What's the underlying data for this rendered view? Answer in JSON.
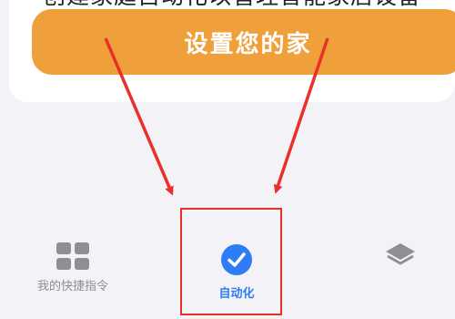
{
  "card": {
    "description": "创建家庭自动化以管理智能家居设备",
    "setup_button_label": "设置您的家"
  },
  "tabbar": {
    "items": [
      {
        "label": "我的快捷指令",
        "icon": "grid-icon",
        "active": false
      },
      {
        "label": "自动化",
        "icon": "checkmark-circle-icon",
        "active": true
      },
      {
        "label": "",
        "icon": "layers-icon",
        "active": false
      }
    ]
  },
  "colors": {
    "button_orange": "#f0a03a",
    "active_blue": "#2e7cf6",
    "inactive_gray": "#8e8e93",
    "annotation_red": "#e8312a",
    "background": "#f2f2f7"
  }
}
